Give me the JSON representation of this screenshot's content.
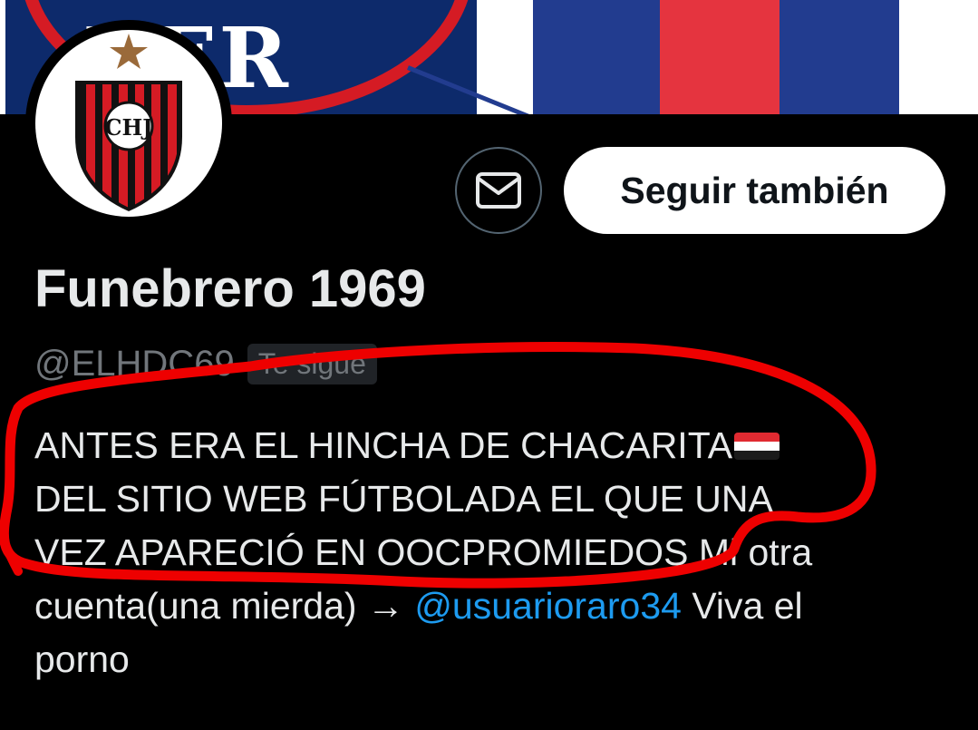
{
  "banner": {
    "text": "VER"
  },
  "profile": {
    "display_name": "Funebrero 1969",
    "handle": "@ELHDC69",
    "follows_you_badge": "Te sigue",
    "avatar_monogram": "CHJ"
  },
  "actions": {
    "message_icon": "mail-icon",
    "follow_label": "Seguir también"
  },
  "bio": {
    "line1": "ANTES ERA EL HINCHA DE CHACARITA",
    "line1_flag": "flag-emoji",
    "line2": "DEL SITIO WEB FÚTBOLADA EL QUE UNA",
    "line3": "VEZ APARECIÓ EN OOCPROMIEDOS",
    "line3_after": " Mi otra",
    "line4_before": "cuenta(una mierda) → ",
    "mention": "@usuarioraro34",
    "line4_after": " Viva el",
    "line5": "porno"
  },
  "colors": {
    "background": "#000000",
    "text_primary": "#e7e9ea",
    "text_secondary": "#71767b",
    "link": "#1d9bf0",
    "annotation_red": "#ee0000"
  }
}
